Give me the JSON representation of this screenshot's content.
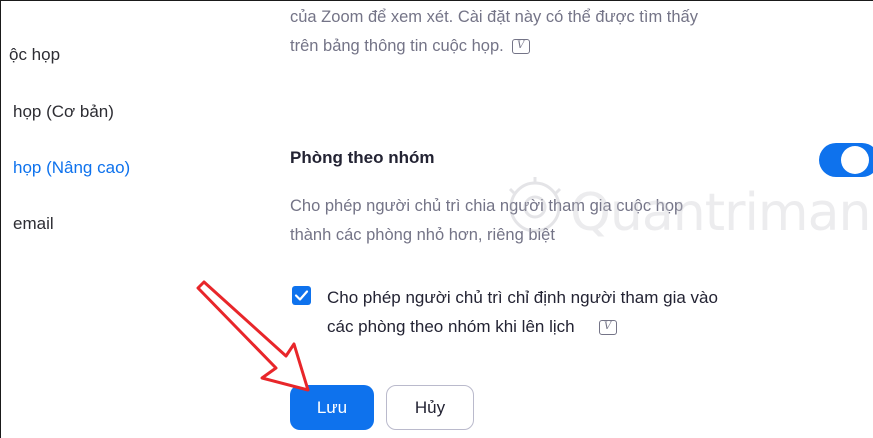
{
  "sidebar": {
    "items": [
      {
        "label": "ộc họp"
      },
      {
        "label": "họp (Cơ bản)"
      },
      {
        "label": "họp (Nâng cao)",
        "active": true
      },
      {
        "label": "email"
      }
    ]
  },
  "main": {
    "top_description": {
      "line1": "của Zoom để xem xét. Cài đặt này có thể được tìm thấy",
      "line2": "trên bảng thông tin cuộc họp."
    },
    "breakout_room": {
      "title": "Phòng theo nhóm",
      "enabled": true,
      "description_line1": "Cho phép người chủ trì chia người tham gia cuộc họp",
      "description_line2": "thành các phòng nhỏ hơn, riêng biệt"
    },
    "assign_option": {
      "checked": true,
      "label_line1": "Cho phép người chủ trì chỉ định người tham gia vào",
      "label_line2": "các phòng theo nhóm khi lên lịch"
    },
    "info_icon_glyph": "V",
    "save_label": "Lưu",
    "cancel_label": "Hủy"
  },
  "watermark": {
    "text": "Quantrimang"
  },
  "colors": {
    "accent": "#0e72ed",
    "text_primary": "#232333",
    "text_secondary": "#747487",
    "annotation_arrow": "#e8262a"
  }
}
